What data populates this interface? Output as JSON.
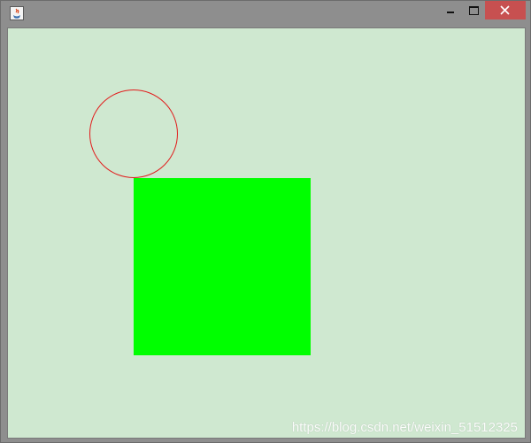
{
  "window": {
    "app_icon": "java-cup-icon",
    "controls": {
      "minimize_icon": "minimize-icon",
      "maximize_icon": "maximize-icon",
      "close_icon": "close-icon"
    },
    "colors": {
      "frame": "#8e8e8e",
      "close_button": "#c75050"
    }
  },
  "canvas": {
    "background": "#cfe8d0",
    "shapes": [
      {
        "kind": "circle",
        "style": "outline",
        "color": "#e21b1b"
      },
      {
        "kind": "square",
        "style": "filled",
        "color": "#00ff00"
      }
    ]
  },
  "watermark": {
    "text": "https://blog.csdn.net/weixin_51512325"
  }
}
